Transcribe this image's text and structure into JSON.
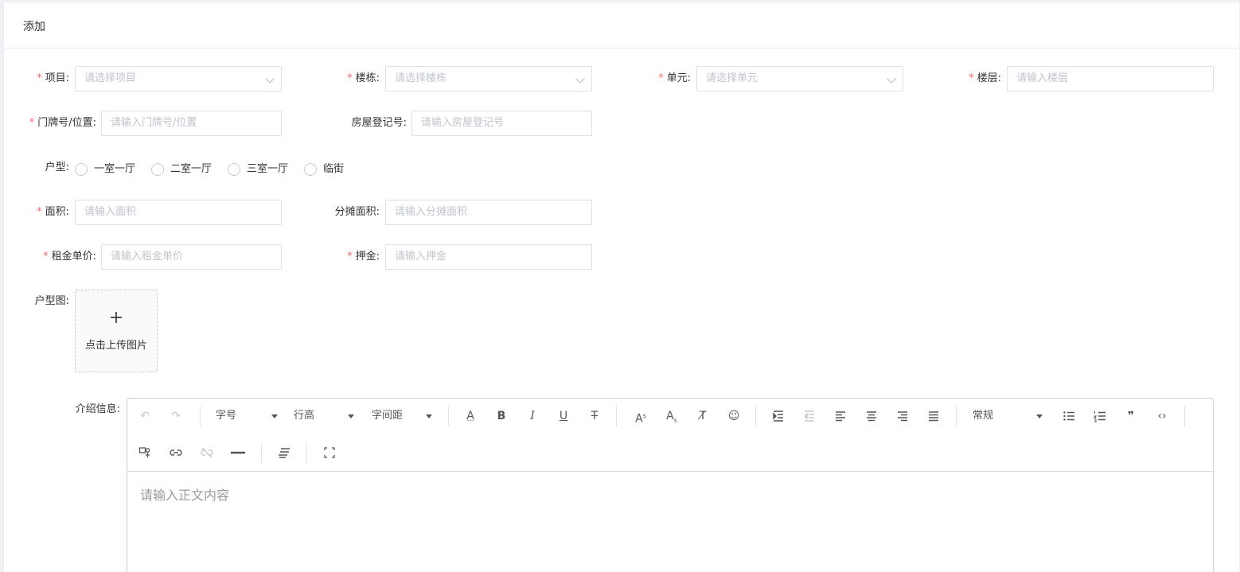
{
  "card": {
    "title": "添加"
  },
  "form": {
    "project": {
      "label": "项目:",
      "placeholder": "请选择项目"
    },
    "building": {
      "label": "楼栋:",
      "placeholder": "请选择楼栋"
    },
    "unit": {
      "label": "单元:",
      "placeholder": "请选择单元"
    },
    "floor": {
      "label": "楼层:",
      "placeholder": "请输入楼层"
    },
    "door_no": {
      "label": "门牌号/位置:",
      "placeholder": "请输入门牌号/位置"
    },
    "reg_no": {
      "label": "房屋登记号:",
      "placeholder": "请输入房屋登记号"
    },
    "house_type": {
      "label": "户型:",
      "options": [
        "一室一厅",
        "二室一厅",
        "三室一厅",
        "临街"
      ]
    },
    "area": {
      "label": "面积:",
      "placeholder": "请输入面积"
    },
    "shared_area": {
      "label": "分摊面积:",
      "placeholder": "请输入分摊面积"
    },
    "rent_price": {
      "label": "租金单价:",
      "placeholder": "请输入租金单价"
    },
    "deposit": {
      "label": "押金:",
      "placeholder": "请输入押金"
    },
    "floor_plan": {
      "label": "户型图:",
      "upload_text": "点击上传图片",
      "plus": "+"
    },
    "intro": {
      "label": "介绍信息:",
      "placeholder": "请输入正文内容"
    },
    "required_mark": "*"
  },
  "toolbar": {
    "font_size": "字号",
    "line_height": "行高",
    "letter_spacing": "字间距",
    "paragraph": "常规",
    "font_color_glyph": "A",
    "bold_glyph": "B",
    "italic_glyph": "I",
    "underline_glyph": "U",
    "strike_glyph": "T",
    "sup_glyph": "A",
    "sub_glyph": "A",
    "sup_mark": "s",
    "sub_mark": "s",
    "undo_glyph": "↶",
    "redo_glyph": "↷",
    "clear_glyph": "T̸",
    "emoji_glyph": "☺",
    "quote_glyph": "❞",
    "code_glyph": "‹›"
  },
  "colors": {
    "required": "#f56c6c",
    "placeholder": "#c0c4cc",
    "border": "#dcdfe6"
  }
}
